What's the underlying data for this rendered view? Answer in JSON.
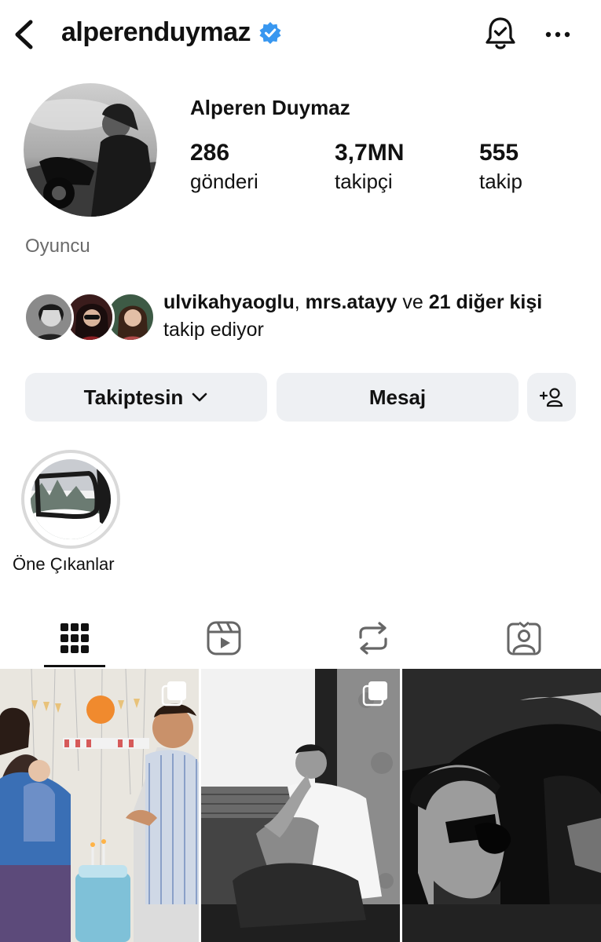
{
  "header": {
    "username": "alperenduymaz",
    "icons": {
      "back": "chevron-left-icon",
      "verified": "verified-badge-icon",
      "notifications": "bell-check-icon",
      "more": "more-horizontal-icon"
    },
    "verified_color": "#3897f0"
  },
  "profile": {
    "full_name": "Alperen Duymaz",
    "stats": [
      {
        "value": "286",
        "label": "gönderi"
      },
      {
        "value": "3,7MN",
        "label": "takipçi"
      },
      {
        "value": "555",
        "label": "takip"
      }
    ],
    "bio": "Oyuncu"
  },
  "followed_by": {
    "user1": "ulvikahyaoglu",
    "sep1": ",",
    "user2": "mrs.atayy",
    "connector": "ve",
    "others": "21 diğer kişi",
    "suffix": "takip ediyor"
  },
  "actions": {
    "follow_label": "Takiptesin",
    "message_label": "Mesaj",
    "icons": {
      "dropdown": "chevron-down-icon",
      "add_user": "add-user-icon"
    }
  },
  "highlights": [
    {
      "label": "Öne Çıkanlar"
    }
  ],
  "tabs": [
    {
      "name": "grid",
      "icon": "grid-icon",
      "active": true
    },
    {
      "name": "reels",
      "icon": "reels-icon",
      "active": false
    },
    {
      "name": "reposts",
      "icon": "repost-icon",
      "active": false
    },
    {
      "name": "tagged",
      "icon": "tagged-person-icon",
      "active": false
    }
  ],
  "posts": [
    {
      "kind": "carousel",
      "icon": "multiple-posts-icon"
    },
    {
      "kind": "carousel",
      "icon": "multiple-posts-icon"
    },
    {
      "kind": "single"
    }
  ],
  "colors": {
    "button_bg": "#eef0f3",
    "muted_text": "#6b6b6b",
    "text": "#111111"
  }
}
